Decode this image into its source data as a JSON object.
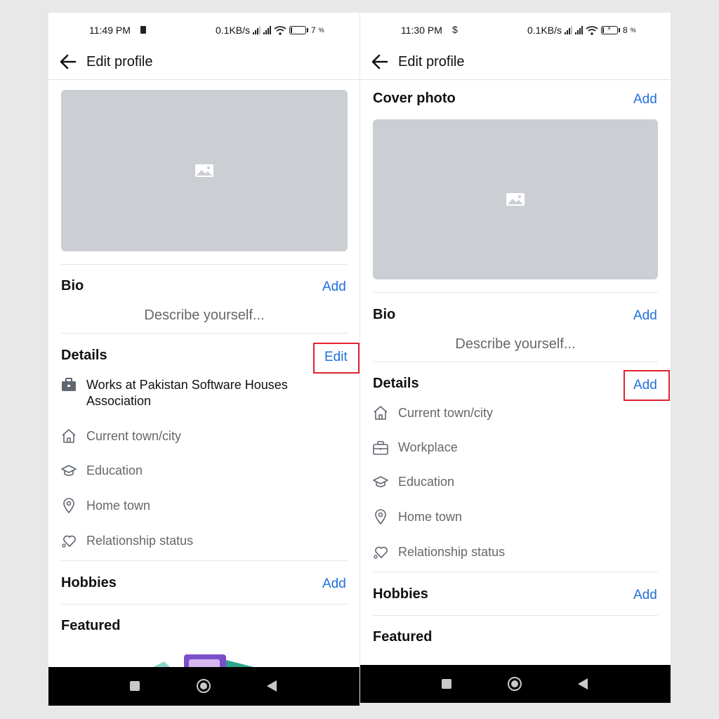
{
  "left": {
    "status": {
      "time": "11:49 PM",
      "speed": "0.1KB/s",
      "battery": "7"
    },
    "header": {
      "title": "Edit profile"
    },
    "bio": {
      "title": "Bio",
      "action": "Add",
      "placeholder": "Describe yourself..."
    },
    "details": {
      "title": "Details",
      "action": "Edit",
      "work_line1": "Works at Pakistan Software Houses",
      "work_line2": "Association",
      "items": [
        "Current town/city",
        "Education",
        "Home town",
        "Relationship status"
      ]
    },
    "hobbies": {
      "title": "Hobbies",
      "action": "Add"
    },
    "featured": {
      "title": "Featured"
    }
  },
  "right": {
    "status": {
      "time": "11:30 PM",
      "speed": "0.1KB/s",
      "battery": "8"
    },
    "header": {
      "title": "Edit profile"
    },
    "cover": {
      "title": "Cover photo",
      "action": "Add"
    },
    "bio": {
      "title": "Bio",
      "action": "Add",
      "placeholder": "Describe yourself..."
    },
    "details": {
      "title": "Details",
      "action": "Add",
      "items": [
        "Current town/city",
        "Workplace",
        "Education",
        "Home town",
        "Relationship status"
      ]
    },
    "hobbies": {
      "title": "Hobbies",
      "action": "Add"
    },
    "featured": {
      "title": "Featured"
    }
  },
  "colors": {
    "link": "#216fdb",
    "highlight": "#e0232e",
    "cover": "#cbced3"
  }
}
